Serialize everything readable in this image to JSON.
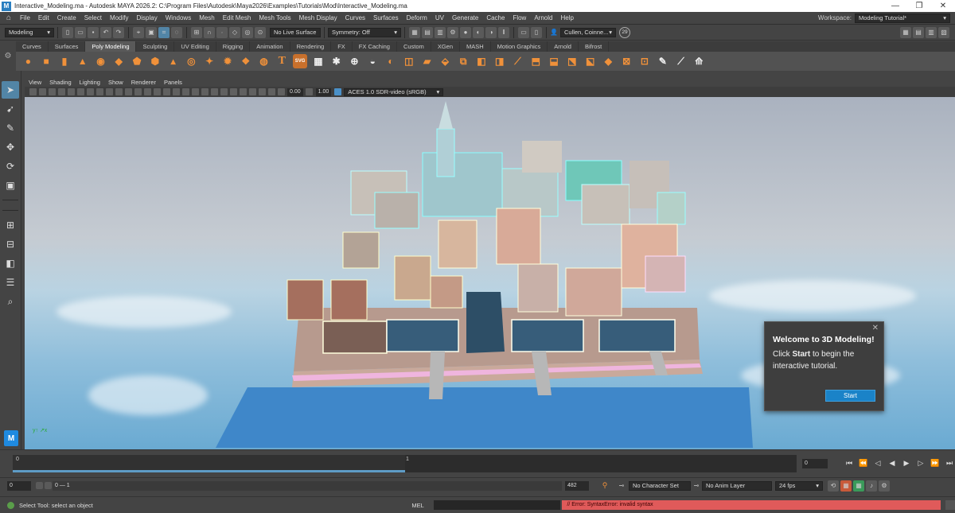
{
  "window": {
    "title": "Interactive_Modeling.ma - Autodesk MAYA 2026.2: C:\\Program Files\\Autodesk\\Maya2026\\Examples\\Tutorials\\Mod\\Interactive_Modeling.ma",
    "logo": "M",
    "minimize": "—",
    "restore": "❐",
    "close": "✕"
  },
  "menubar": {
    "items": [
      "File",
      "Edit",
      "Create",
      "Select",
      "Modify",
      "Display",
      "Windows",
      "Mesh",
      "Edit Mesh",
      "Mesh Tools",
      "Mesh Display",
      "Curves",
      "Surfaces",
      "Deform",
      "UV",
      "Generate",
      "Cache",
      "Flow",
      "Arnold",
      "Help"
    ],
    "workspace_label": "Workspace:",
    "workspace_value": "Modeling Tutorial*"
  },
  "statusline": {
    "menuset": "Modeling",
    "live_surface": "No Live Surface",
    "symmetry": "Symmetry: Off",
    "user": "Cullen, Coinne...",
    "notifications": "29"
  },
  "shelf": {
    "tabs": [
      "Curves",
      "Surfaces",
      "Poly Modeling",
      "Sculpting",
      "UV Editing",
      "Rigging",
      "Animation",
      "Rendering",
      "FX",
      "FX Caching",
      "Custom",
      "XGen",
      "MASH",
      "Motion Graphics",
      "Arnold",
      "Bifrost"
    ],
    "active_tab": "Poly Modeling",
    "text_tool": "T",
    "svg_tool": "SVG"
  },
  "panel": {
    "menus": [
      "View",
      "Shading",
      "Lighting",
      "Show",
      "Renderer",
      "Panels"
    ],
    "exposure": "0.00",
    "gamma": "1.00",
    "color_space": "ACES 1.0 SDR-video (sRGB)"
  },
  "welcome": {
    "title": "Welcome to 3D Modeling!",
    "line1_pre": "Click ",
    "line1_bold": "Start",
    "line1_post": " to begin the interactive tutorial.",
    "button": "Start",
    "close": "✕"
  },
  "timeslider": {
    "start_label": "0",
    "mid_label": "1",
    "current_frame": "0",
    "progress_fraction": 0.5
  },
  "range": {
    "start": "0",
    "range_label": "0 — 1",
    "end": "482",
    "character_set": "No Character Set",
    "anim_layer": "No Anim Layer",
    "fps": "24 fps"
  },
  "commandline": {
    "help": "Select Tool: select an object",
    "lang": "MEL",
    "error": "// Error: SyntaxError: invalid syntax"
  },
  "colors": {
    "accent": "#5285a6",
    "shelf_orange": "#f0913a",
    "error_red": "#e05a5a",
    "start_blue": "#1a83c8"
  }
}
